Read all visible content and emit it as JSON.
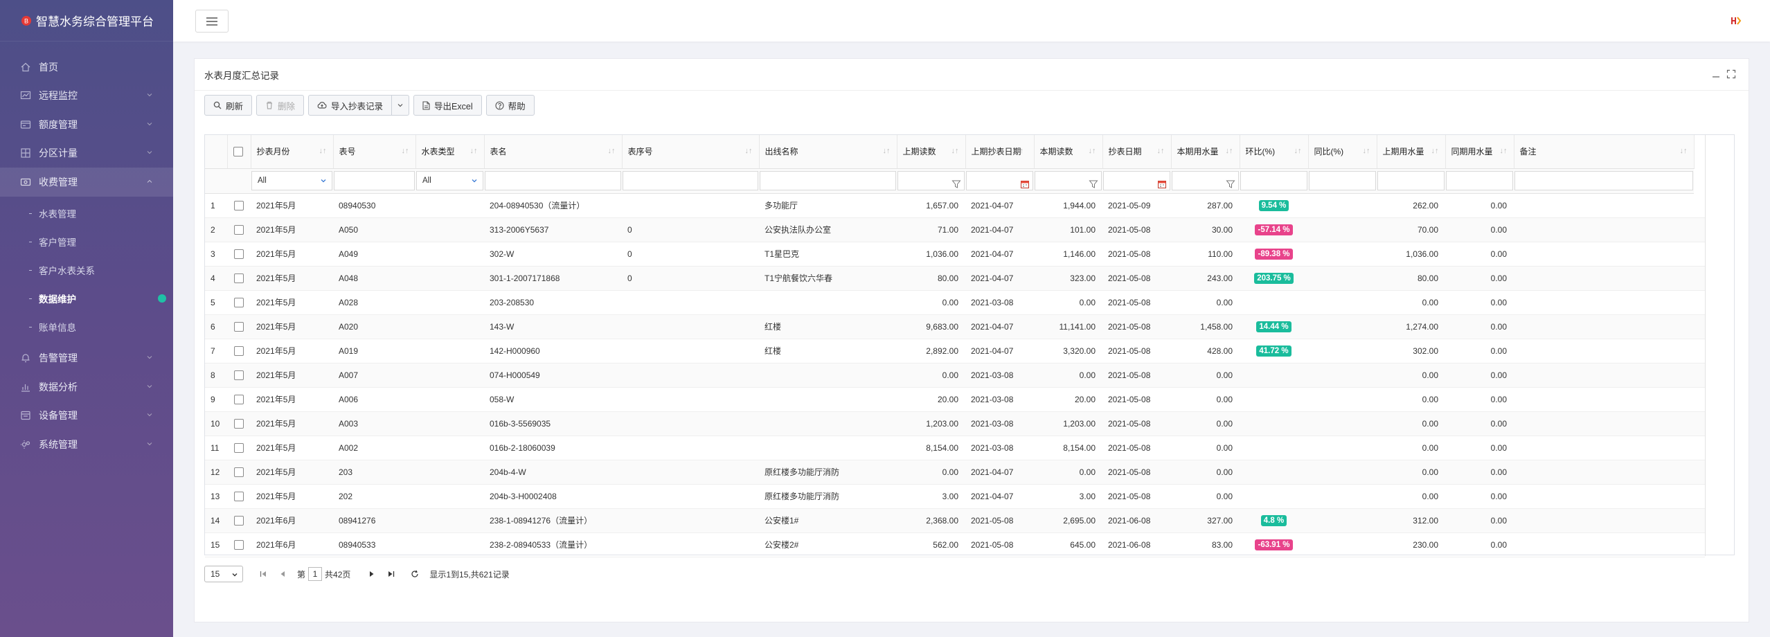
{
  "app": {
    "title": "智慧水务综合管理平台"
  },
  "nav": {
    "items": [
      {
        "label": "首页",
        "icon": "home-icon"
      },
      {
        "label": "远程监控",
        "icon": "monitor-chart-icon"
      },
      {
        "label": "额度管理",
        "icon": "quota-icon"
      },
      {
        "label": "分区计量",
        "icon": "partition-icon"
      },
      {
        "label": "收费管理",
        "icon": "fee-icon"
      }
    ],
    "sub_items": [
      {
        "label": "水表管理"
      },
      {
        "label": "客户管理"
      },
      {
        "label": "客户水表关系"
      },
      {
        "label": "数据维护"
      },
      {
        "label": "账单信息"
      }
    ],
    "items_after": [
      {
        "label": "告警管理",
        "icon": "alarm-icon"
      },
      {
        "label": "数据分析",
        "icon": "analysis-icon"
      },
      {
        "label": "设备管理",
        "icon": "device-icon"
      },
      {
        "label": "系统管理",
        "icon": "settings-icon"
      }
    ]
  },
  "panel": {
    "title": "水表月度汇总记录"
  },
  "toolbar": {
    "refresh": "刷新",
    "delete": "删除",
    "import": "导入抄表记录",
    "export": "导出Excel",
    "help": "帮助"
  },
  "table": {
    "columns": [
      "抄表月份",
      "表号",
      "水表类型",
      "表名",
      "表序号",
      "出线名称",
      "上期读数",
      "上期抄表日期",
      "本期读数",
      "抄表日期",
      "本期用水量",
      "环比(%)",
      "同比(%)",
      "上期用水量",
      "同期用水量",
      "备注"
    ],
    "filters": {
      "month": "All",
      "type": "All"
    },
    "rows": [
      {
        "n": "1",
        "month": "2021年5月",
        "meter": "08940530",
        "type": "",
        "name": "204-08940530（流量计）",
        "seq": "",
        "line": "多功能厅",
        "prev": "1,657.00",
        "prev_date": "2021-04-07",
        "cur": "1,944.00",
        "date": "2021-05-09",
        "usage": "287.00",
        "mom": "9.54 %",
        "mom_dir": "up",
        "yoy": "",
        "last": "262.00",
        "same": "0.00",
        "note": ""
      },
      {
        "n": "2",
        "month": "2021年5月",
        "meter": "A050",
        "type": "",
        "name": "313-2006Y5637",
        "seq": "0",
        "line": "公安执法队办公室",
        "prev": "71.00",
        "prev_date": "2021-04-07",
        "cur": "101.00",
        "date": "2021-05-08",
        "usage": "30.00",
        "mom": "-57.14 %",
        "mom_dir": "down",
        "yoy": "",
        "last": "70.00",
        "same": "0.00",
        "note": ""
      },
      {
        "n": "3",
        "month": "2021年5月",
        "meter": "A049",
        "type": "",
        "name": "302-W",
        "seq": "0",
        "line": "T1星巴克",
        "prev": "1,036.00",
        "prev_date": "2021-04-07",
        "cur": "1,146.00",
        "date": "2021-05-08",
        "usage": "110.00",
        "mom": "-89.38 %",
        "mom_dir": "down",
        "yoy": "",
        "last": "1,036.00",
        "same": "0.00",
        "note": ""
      },
      {
        "n": "4",
        "month": "2021年5月",
        "meter": "A048",
        "type": "",
        "name": "301-1-2007171868",
        "seq": "0",
        "line": "T1宁航餐饮六华春",
        "prev": "80.00",
        "prev_date": "2021-04-07",
        "cur": "323.00",
        "date": "2021-05-08",
        "usage": "243.00",
        "mom": "203.75 %",
        "mom_dir": "up",
        "yoy": "",
        "last": "80.00",
        "same": "0.00",
        "note": ""
      },
      {
        "n": "5",
        "month": "2021年5月",
        "meter": "A028",
        "type": "",
        "name": "203-208530",
        "seq": "",
        "line": "",
        "prev": "0.00",
        "prev_date": "2021-03-08",
        "cur": "0.00",
        "date": "2021-05-08",
        "usage": "0.00",
        "mom": "",
        "mom_dir": "",
        "yoy": "",
        "last": "0.00",
        "same": "0.00",
        "note": ""
      },
      {
        "n": "6",
        "month": "2021年5月",
        "meter": "A020",
        "type": "",
        "name": "143-W",
        "seq": "",
        "line": "红楼",
        "prev": "9,683.00",
        "prev_date": "2021-04-07",
        "cur": "11,141.00",
        "date": "2021-05-08",
        "usage": "1,458.00",
        "mom": "14.44 %",
        "mom_dir": "up",
        "yoy": "",
        "last": "1,274.00",
        "same": "0.00",
        "note": ""
      },
      {
        "n": "7",
        "month": "2021年5月",
        "meter": "A019",
        "type": "",
        "name": "142-H000960",
        "seq": "",
        "line": "红楼",
        "prev": "2,892.00",
        "prev_date": "2021-04-07",
        "cur": "3,320.00",
        "date": "2021-05-08",
        "usage": "428.00",
        "mom": "41.72 %",
        "mom_dir": "up",
        "yoy": "",
        "last": "302.00",
        "same": "0.00",
        "note": ""
      },
      {
        "n": "8",
        "month": "2021年5月",
        "meter": "A007",
        "type": "",
        "name": "074-H000549",
        "seq": "",
        "line": "",
        "prev": "0.00",
        "prev_date": "2021-03-08",
        "cur": "0.00",
        "date": "2021-05-08",
        "usage": "0.00",
        "mom": "",
        "mom_dir": "",
        "yoy": "",
        "last": "0.00",
        "same": "0.00",
        "note": ""
      },
      {
        "n": "9",
        "month": "2021年5月",
        "meter": "A006",
        "type": "",
        "name": "058-W",
        "seq": "",
        "line": "",
        "prev": "20.00",
        "prev_date": "2021-03-08",
        "cur": "20.00",
        "date": "2021-05-08",
        "usage": "0.00",
        "mom": "",
        "mom_dir": "",
        "yoy": "",
        "last": "0.00",
        "same": "0.00",
        "note": ""
      },
      {
        "n": "10",
        "month": "2021年5月",
        "meter": "A003",
        "type": "",
        "name": "016b-3-5569035",
        "seq": "",
        "line": "",
        "prev": "1,203.00",
        "prev_date": "2021-03-08",
        "cur": "1,203.00",
        "date": "2021-05-08",
        "usage": "0.00",
        "mom": "",
        "mom_dir": "",
        "yoy": "",
        "last": "0.00",
        "same": "0.00",
        "note": ""
      },
      {
        "n": "11",
        "month": "2021年5月",
        "meter": "A002",
        "type": "",
        "name": "016b-2-18060039",
        "seq": "",
        "line": "",
        "prev": "8,154.00",
        "prev_date": "2021-03-08",
        "cur": "8,154.00",
        "date": "2021-05-08",
        "usage": "0.00",
        "mom": "",
        "mom_dir": "",
        "yoy": "",
        "last": "0.00",
        "same": "0.00",
        "note": ""
      },
      {
        "n": "12",
        "month": "2021年5月",
        "meter": "203",
        "type": "",
        "name": "204b-4-W",
        "seq": "",
        "line": "原红楼多功能厅消防",
        "prev": "0.00",
        "prev_date": "2021-04-07",
        "cur": "0.00",
        "date": "2021-05-08",
        "usage": "0.00",
        "mom": "",
        "mom_dir": "",
        "yoy": "",
        "last": "0.00",
        "same": "0.00",
        "note": ""
      },
      {
        "n": "13",
        "month": "2021年5月",
        "meter": "202",
        "type": "",
        "name": "204b-3-H0002408",
        "seq": "",
        "line": "原红楼多功能厅消防",
        "prev": "3.00",
        "prev_date": "2021-04-07",
        "cur": "3.00",
        "date": "2021-05-08",
        "usage": "0.00",
        "mom": "",
        "mom_dir": "",
        "yoy": "",
        "last": "0.00",
        "same": "0.00",
        "note": ""
      },
      {
        "n": "14",
        "month": "2021年6月",
        "meter": "08941276",
        "type": "",
        "name": "238-1-08941276（流量计）",
        "seq": "",
        "line": "公安楼1#",
        "prev": "2,368.00",
        "prev_date": "2021-05-08",
        "cur": "2,695.00",
        "date": "2021-06-08",
        "usage": "327.00",
        "mom": "4.8 %",
        "mom_dir": "up",
        "yoy": "",
        "last": "312.00",
        "same": "0.00",
        "note": ""
      },
      {
        "n": "15",
        "month": "2021年6月",
        "meter": "08940533",
        "type": "",
        "name": "238-2-08940533（流量计）",
        "seq": "",
        "line": "公安楼2#",
        "prev": "562.00",
        "prev_date": "2021-05-08",
        "cur": "645.00",
        "date": "2021-06-08",
        "usage": "83.00",
        "mom": "-63.91 %",
        "mom_dir": "down",
        "yoy": "",
        "last": "230.00",
        "same": "0.00",
        "note": ""
      }
    ]
  },
  "pager": {
    "page_size": "15",
    "page_label_before": "第",
    "page": "1",
    "page_label_after": "共42页",
    "summary": "显示1到15,共621记录"
  },
  "colors": {
    "accent_up": "#1abc9c",
    "accent_down": "#e8438b",
    "sidebar_top": "#4d4f88",
    "sidebar_bottom": "#6a4f8c"
  }
}
